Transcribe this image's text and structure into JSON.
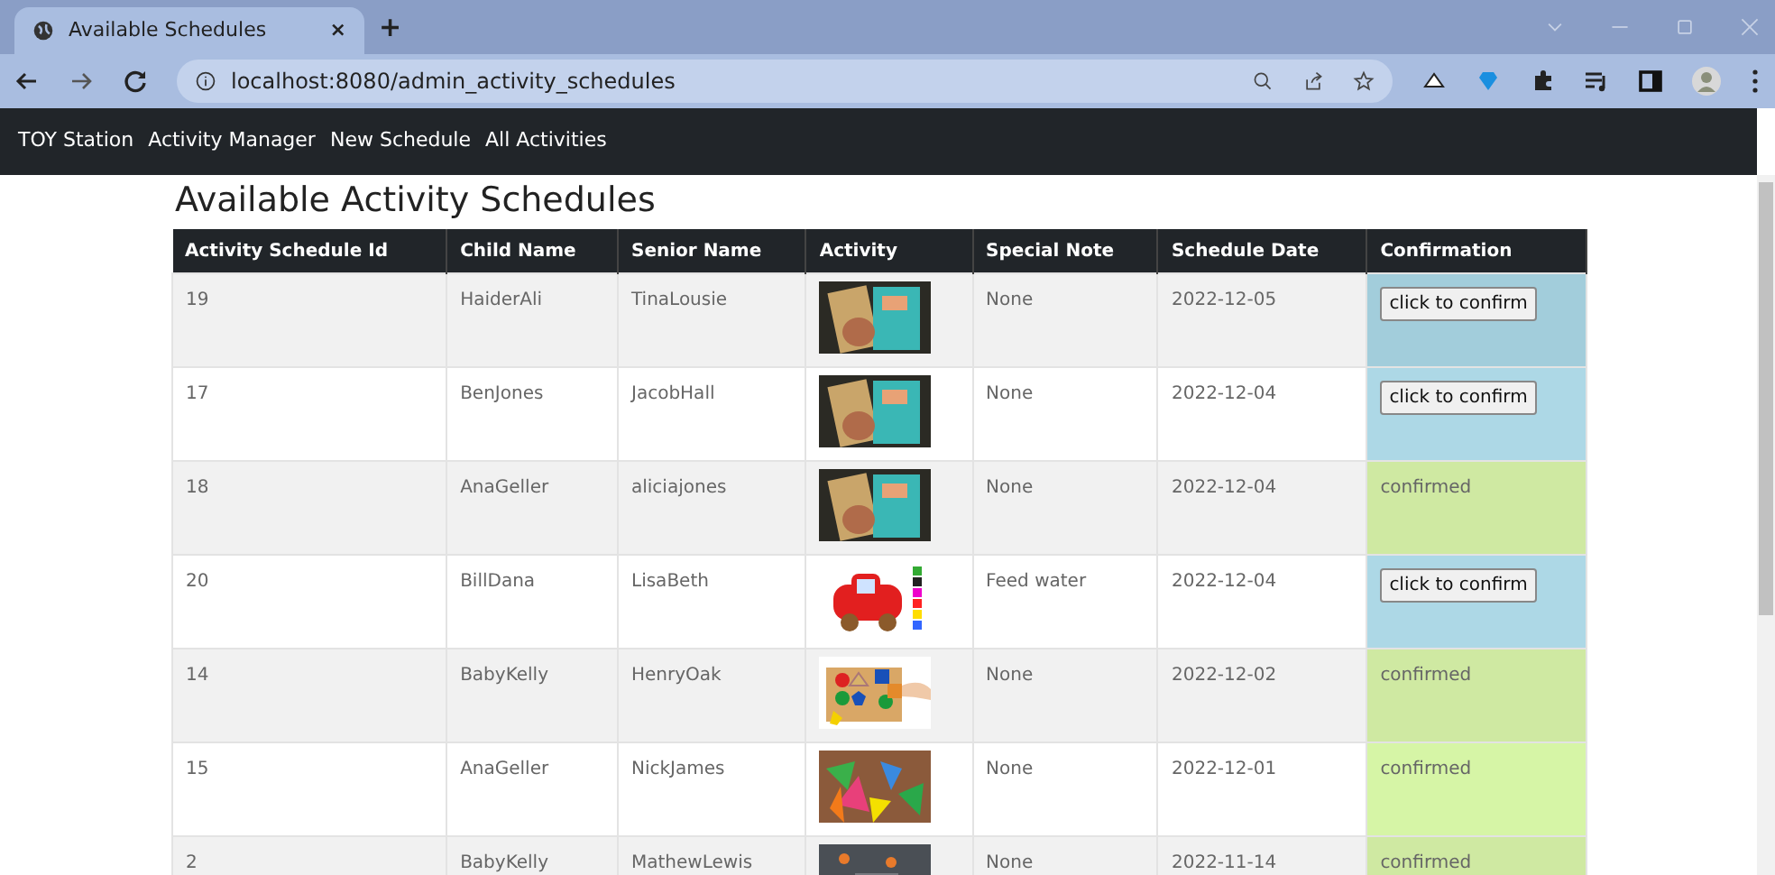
{
  "browser": {
    "tab_title": "Available Schedules",
    "tab_close": "×",
    "new_tab": "+",
    "url": "localhost:8080/admin_activity_schedules"
  },
  "navbar": {
    "brand": "TOY Station",
    "links": [
      "Activity Manager",
      "New Schedule",
      "All Activities"
    ]
  },
  "heading": "Available Activity Schedules",
  "table": {
    "columns": [
      "Activity Schedule Id",
      "Child Name",
      "Senior Name",
      "Activity",
      "Special Note",
      "Schedule Date",
      "Confirmation"
    ],
    "rows": [
      {
        "id": "19",
        "child": "HaiderAli",
        "senior": "TinaLousie",
        "note": "None",
        "date": "2022-12-05",
        "confirmed": false,
        "confirmation": "click to confirm"
      },
      {
        "id": "17",
        "child": "BenJones",
        "senior": "JacobHall",
        "note": "None",
        "date": "2022-12-04",
        "confirmed": false,
        "confirmation": "click to confirm"
      },
      {
        "id": "18",
        "child": "AnaGeller",
        "senior": "aliciajones",
        "note": "None",
        "date": "2022-12-04",
        "confirmed": true,
        "confirmation": "confirmed"
      },
      {
        "id": "20",
        "child": "BillDana",
        "senior": "LisaBeth",
        "note": "Feed water",
        "date": "2022-12-04",
        "confirmed": false,
        "confirmation": "click to confirm"
      },
      {
        "id": "14",
        "child": "BabyKelly",
        "senior": "HenryOak",
        "note": "None",
        "date": "2022-12-02",
        "confirmed": true,
        "confirmation": "confirmed"
      },
      {
        "id": "15",
        "child": "AnaGeller",
        "senior": "NickJames",
        "note": "None",
        "date": "2022-12-01",
        "confirmed": true,
        "confirmation": "confirmed"
      },
      {
        "id": "2",
        "child": "BabyKelly",
        "senior": "MathewLewis",
        "note": "None",
        "date": "2022-11-14",
        "confirmed": true,
        "confirmation": "confirmed"
      }
    ]
  }
}
